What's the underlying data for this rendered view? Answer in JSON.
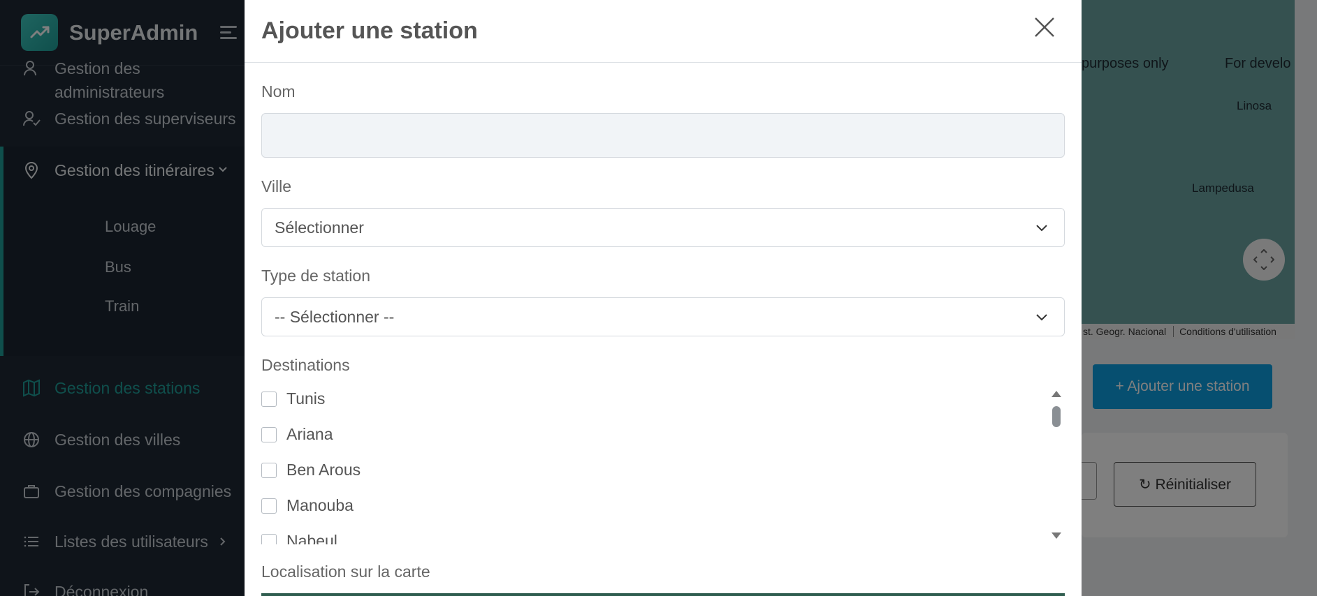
{
  "sidebar": {
    "brand": "SuperAdmin",
    "items": [
      {
        "label": "Gestion des",
        "label2": "administrateurs",
        "icon": "users-icon"
      },
      {
        "label": "Gestion des superviseurs",
        "icon": "user-check-icon"
      },
      {
        "label": "Gestion des itinéraires",
        "icon": "map-pin-icon"
      },
      {
        "label": "Gestion des stations",
        "icon": "map-icon"
      },
      {
        "label": "Gestion des villes",
        "icon": "globe-icon"
      },
      {
        "label": "Gestion des compagnies",
        "icon": "briefcase-icon"
      },
      {
        "label": "Listes des utilisateurs",
        "icon": "list-icon"
      },
      {
        "label": "Déconnexion",
        "icon": "logout-icon"
      }
    ],
    "subitems": [
      "Louage",
      "Bus",
      "Train"
    ]
  },
  "background": {
    "map_text_1": "purposes only",
    "map_text_2": "For develo",
    "place_1": "Linosa",
    "place_2": "Lampedusa",
    "attribution_1": "st. Geogr. Nacional",
    "attribution_2": "Conditions d'utilisation",
    "add_button": "+ Ajouter une station",
    "reset_button": "↻ Réinitialiser"
  },
  "modal": {
    "title": "Ajouter une station",
    "name_label": "Nom",
    "name_value": "",
    "city_label": "Ville",
    "city_value": "Sélectionner",
    "type_label": "Type de station",
    "type_value": "-- Sélectionner --",
    "destinations_label": "Destinations",
    "destinations": [
      "Tunis",
      "Ariana",
      "Ben Arous",
      "Manouba",
      "Nabeul"
    ],
    "map_label": "Localisation sur la carte"
  },
  "colors": {
    "accent": "#1f9f98",
    "primary_button": "#0d9fe0",
    "sidebar_bg": "#1e2935"
  }
}
